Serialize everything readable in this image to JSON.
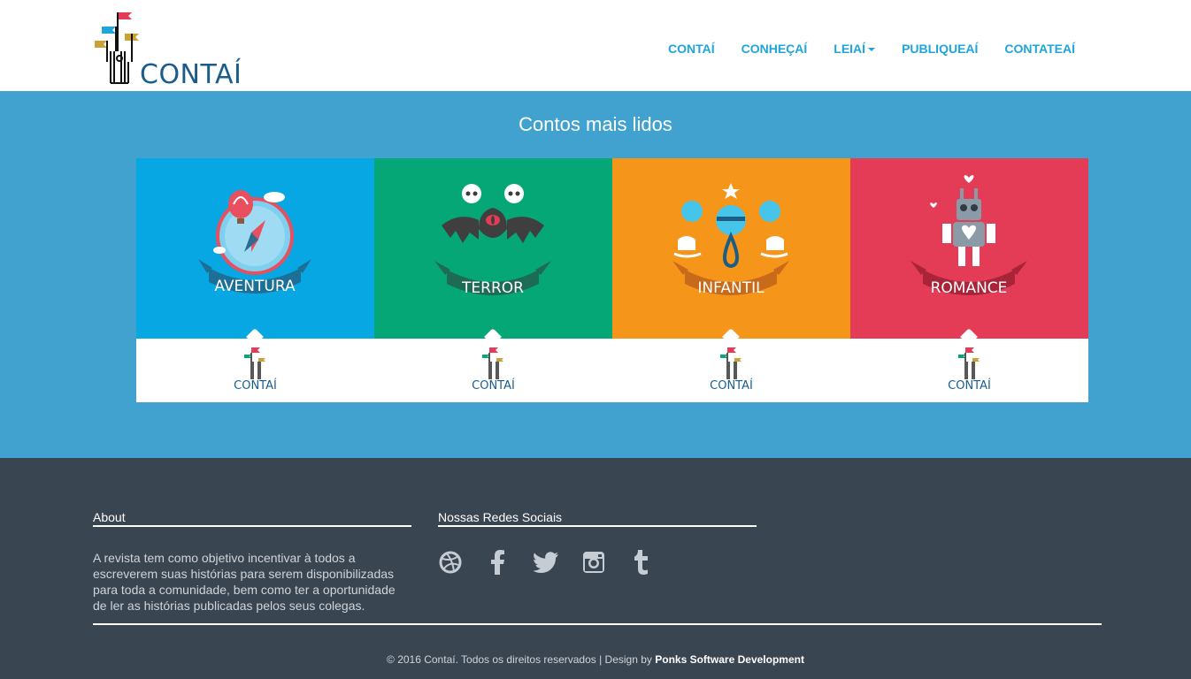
{
  "brand": {
    "name": "CONTAÍ"
  },
  "nav": {
    "items": [
      {
        "label": "CONTAÍ"
      },
      {
        "label": "CONHEÇAÍ"
      },
      {
        "label": "LEIAÍ"
      },
      {
        "label": "PUBLIQUEAÍ"
      },
      {
        "label": "CONTATEAÍ"
      }
    ]
  },
  "stories": {
    "title": "Contos mais lidos",
    "cards": [
      {
        "genre": "AVENTURA",
        "color": "#07a7e3",
        "footer_brand": "CONTAÍ",
        "icon": "compass-balloon-icon"
      },
      {
        "genre": "TERROR",
        "color": "#06a776",
        "footer_brand": "CONTAÍ",
        "icon": "bat-skulls-icon"
      },
      {
        "genre": "INFANTIL",
        "color": "#f5951a",
        "footer_brand": "CONTAÍ",
        "icon": "rattle-toys-icon"
      },
      {
        "genre": "ROMANCE",
        "color": "#e43b56",
        "footer_brand": "CONTAÍ",
        "icon": "robot-heart-icon"
      }
    ]
  },
  "footer": {
    "about_title": "About",
    "about_text": "A revista tem como objetivo incentivar à todos a escreverem suas histórias para serem disponibilizadas para toda a comunidade, bem como ter a oportunidade de ler as histórias publicadas pelos seus colegas.",
    "social_title": "Nossas Redes Sociais",
    "social_icons": [
      "dribbble-icon",
      "facebook-icon",
      "twitter-icon",
      "instagram-icon",
      "tumblr-icon"
    ],
    "copyright_text": "© 2016 Contaí. Todos os direitos reservados | Design by ",
    "designer": "Ponks Software Development"
  }
}
